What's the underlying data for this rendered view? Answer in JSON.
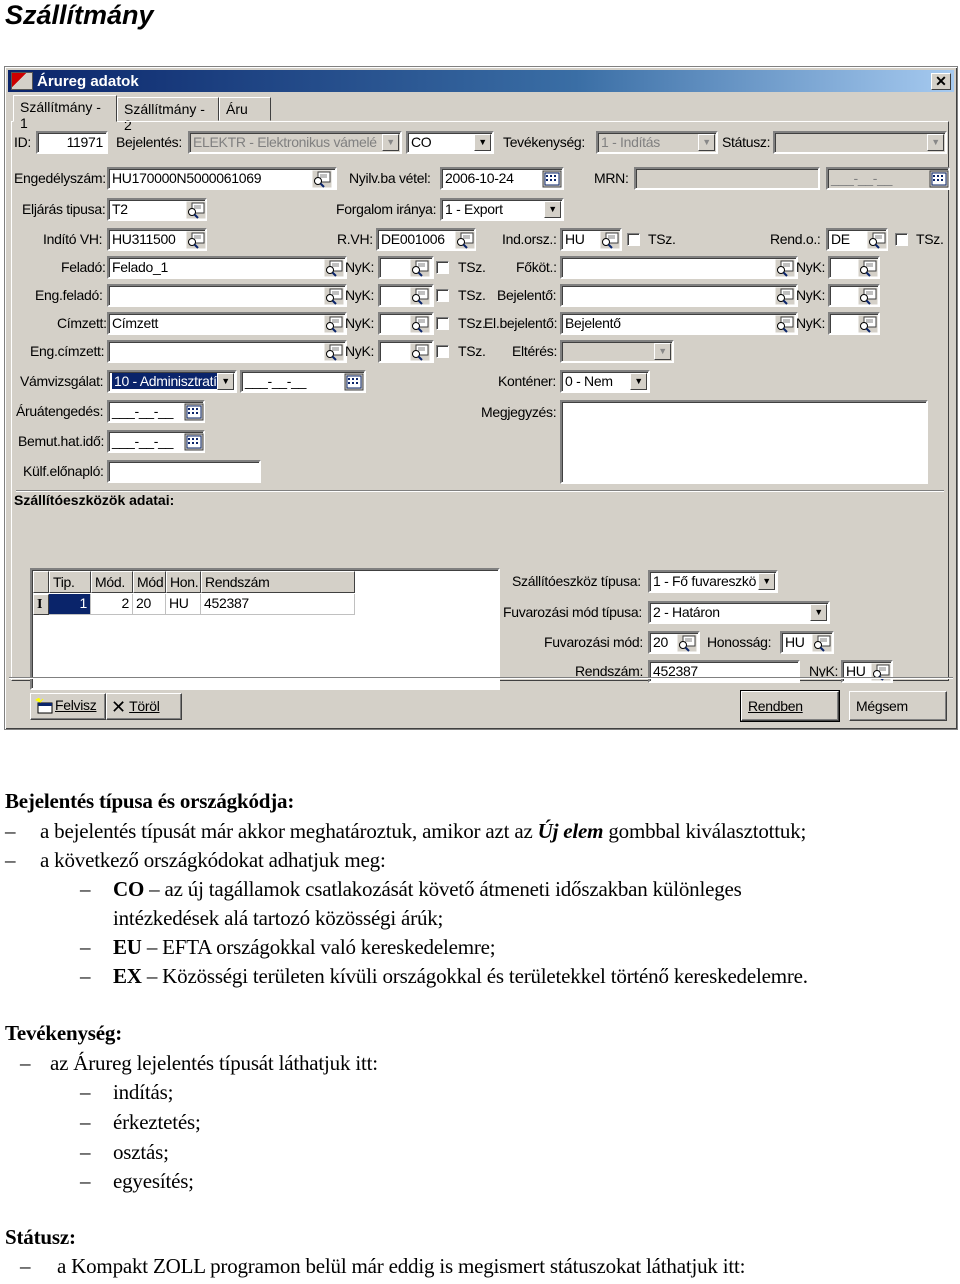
{
  "document": {
    "title": "Szállítmány"
  },
  "dialog": {
    "title": "Árureg adatok",
    "close": "✕",
    "tabs": [
      "Szállítmány - 1",
      "Szállítmány - 2",
      "Áru"
    ],
    "fields": {
      "id": {
        "label": "ID:",
        "value": "11971"
      },
      "bejelentes": {
        "label": "Bejelentés:",
        "value": "ELEKTR - Elektronikus vámelé"
      },
      "country_code": {
        "value": "CO"
      },
      "tevekenyseg": {
        "label": "Tevékenység:",
        "value": "1 - Indítás"
      },
      "statusz": {
        "label": "Státusz:",
        "value": ""
      },
      "engedelyszam": {
        "label": "Engedélyszám:",
        "value": "HU170000N5000061069"
      },
      "nyilv_ba_vetel": {
        "label": "Nyilv.ba vétel:",
        "value": "2006-10-24"
      },
      "mrn": {
        "label": "MRN:",
        "value": ""
      },
      "mrn_date": {
        "value": "___-__-__"
      },
      "eljaras_tipusa": {
        "label": "Eljárás tipusa:",
        "value": "T2"
      },
      "forgalom_iranya": {
        "label": "Forgalom iránya:",
        "value": "1 - Export"
      },
      "indito_vh": {
        "label": "Indító VH:",
        "value": "HU311500"
      },
      "r_vh": {
        "label": "R.VH:",
        "value": "DE001006"
      },
      "ind_orsz": {
        "label": "Ind.orsz.:",
        "value": "HU"
      },
      "rend_o": {
        "label": "Rend.o.:",
        "value": "DE"
      },
      "felado": {
        "label": "Feladó:",
        "value": "Felado_1"
      },
      "eng_felado": {
        "label": "Eng.feladó:",
        "value": ""
      },
      "cimzett": {
        "label": "Címzett:",
        "value": "Címzett"
      },
      "eng_cimzett": {
        "label": "Eng.címzett:",
        "value": ""
      },
      "fokot": {
        "label": "Főköt.:",
        "value": ""
      },
      "bejelento": {
        "label": "Bejelentő:",
        "value": ""
      },
      "el_bejelento": {
        "label": "El.bejelentő:",
        "value": "Bejelentő"
      },
      "elteres": {
        "label": "Eltérés:",
        "value": ""
      },
      "vamvizsgalat": {
        "label": "Vámvizsgálat:",
        "value": "10 - Adminisztratí",
        "date": "___-__-__"
      },
      "kontener": {
        "label": "Konténer:",
        "value": "0 - Nem"
      },
      "aruatengedes": {
        "label": "Áruátengedés:",
        "value": "___-__-__"
      },
      "megjegyzes": {
        "label": "Megjegyzés:",
        "value": ""
      },
      "bemut_hat_ido": {
        "label": "Bemut.hat.idő:",
        "value": "___-__-__"
      },
      "kulf_elonaplo": {
        "label": "Külf.előnapló:",
        "value": ""
      }
    },
    "nyk_label": "NyK:",
    "tsz_label": "TSz.",
    "transport": {
      "section_title": "Szállítóeszközök adatai:",
      "columns": [
        "Tip.",
        "Mód.",
        "Mód",
        "Hon.",
        "Rendszám"
      ],
      "rows": [
        {
          "indicator": "I",
          "cells": [
            "1",
            "2",
            "20",
            "HU",
            "452387"
          ]
        }
      ],
      "add_button": "Felvisz",
      "delete_button": "Töröl",
      "eszkoz_tipusa": {
        "label": "Szállítóeszköz típusa:",
        "value": "1 - Fő fuvareszkö"
      },
      "fuvar_mod_tipusa": {
        "label": "Fuvarozási mód típusa:",
        "value": "2 - Határon"
      },
      "fuvar_mod": {
        "label": "Fuvarozási mód:",
        "value": "20"
      },
      "honossag": {
        "label": "Honosság:",
        "value": "HU"
      },
      "rendszam": {
        "label": "Rendszám:",
        "value": "452387"
      },
      "nyk": {
        "label": "NyK:",
        "value": "HU"
      }
    },
    "ok_button": "Rendben",
    "cancel_button": "Mégsem"
  },
  "text": {
    "s1_title": "Bejelentés típusa és országkódja:",
    "s1_items": [
      {
        "pre": "a bejelentés típusát már akkor meghatároztuk, amikor azt az ",
        "em": "Új elem",
        "post": " gombbal kiválasztottuk;"
      },
      {
        "pre": "a következő országkódokat adhatjuk meg:"
      }
    ],
    "s1_sub": [
      {
        "code": "CO",
        "text": " – az új tagállamok csatlakozását követő átmeneti időszakban különleges",
        "cont": "intézkedések alá tartozó közösségi árúk;"
      },
      {
        "code": "EU",
        "text": " – EFTA országokkal való kereskedelemre;"
      },
      {
        "code": "EX",
        "text": " – Közösségi területen kívüli országokkal és területekkel történő kereskedelemre."
      }
    ],
    "s2_title": "Tevékenység:",
    "s2_item": "az Árureg lejelentés típusát láthatjuk itt:",
    "s2_sub": [
      "indítás;",
      "érkeztetés;",
      "osztás;",
      "egyesítés;"
    ],
    "s3_title": "Státusz:",
    "s3_item": "a Kompakt ZOLL programon belül már eddig is megismert státuszokat láthatjuk itt:",
    "dash": "–"
  }
}
